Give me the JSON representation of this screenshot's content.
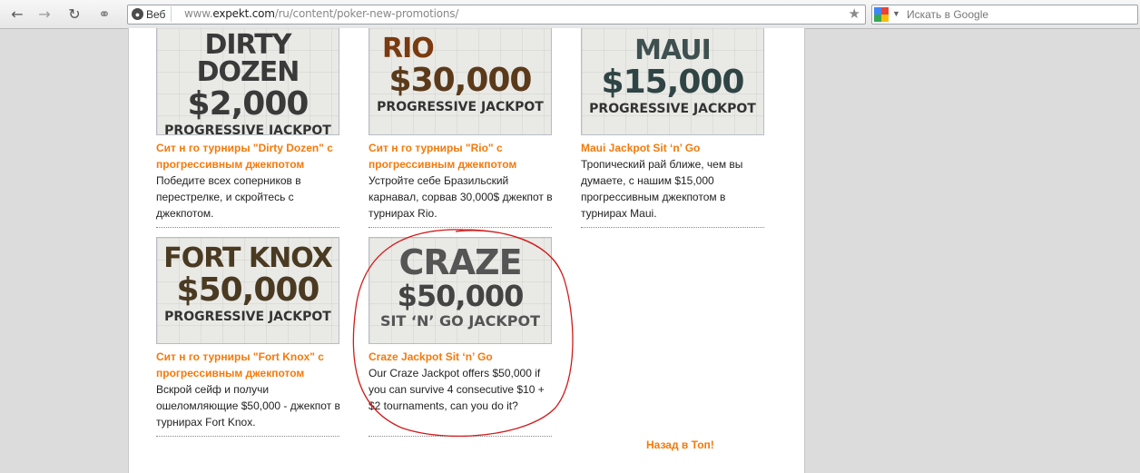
{
  "browser": {
    "search_scope": "Веб",
    "url_prefix": "www.",
    "url_host": "expekt.com",
    "url_path": "/ru/content/poker-new-promotions/",
    "search_placeholder": "Искать в Google"
  },
  "promotions": [
    {
      "image_lines": [
        "DIRTY DOZEN",
        "$2,000",
        "PROGRESSIVE JACKPOT"
      ],
      "title": "Сит н го турниры \"Dirty Dozen\" с прогрессивным джекпотом",
      "description": "Победите всех соперников в перестрелке, и скройтесь с джекпотом."
    },
    {
      "image_lines": [
        "RIO",
        "$30,000",
        "PROGRESSIVE JACKPOT"
      ],
      "title": "Сит н го турниры \"Rio\" с прогрессивным джекпотом",
      "description": "Устройте себе Бразильский карнавал, сорвав 30,000$ джекпот в турнирах Rio."
    },
    {
      "image_lines": [
        "MAUI",
        "$15,000",
        "PROGRESSIVE JACKPOT"
      ],
      "title": "Maui Jackpot Sit ‘n’ Go",
      "description": "Тропический рай ближе, чем вы думаете, с нашим $15,000 прогрессивным джекпотом в турнирах Maui."
    },
    {
      "image_lines": [
        "FORT KNOX",
        "$50,000",
        "PROGRESSIVE JACKPOT"
      ],
      "title": "Сит н го турниры \"Fort Knox\" с прогрессивным джекпотом",
      "description": "Вскрой сейф и получи ошеломляющие $50,000 - джекпот в турнирах Fort Knox."
    },
    {
      "image_lines": [
        "CRAZE",
        "$50,000",
        "SIT ‘N’ GO JACKPOT"
      ],
      "title": "Craze Jackpot Sit ‘n’ Go",
      "description": "Our Craze Jackpot offers $50,000 if you can survive 4 consecutive $10 + $2 tournaments, can you do it?"
    }
  ],
  "back_to_top": "Назад в Топ!",
  "colors": {
    "link_orange": "#f47a0b",
    "annotation_red": "#d21a1a"
  },
  "icons": [
    "back-arrow-icon",
    "forward-arrow-icon",
    "reload-icon",
    "key-icon",
    "globe-icon",
    "star-icon",
    "google-icon"
  ]
}
